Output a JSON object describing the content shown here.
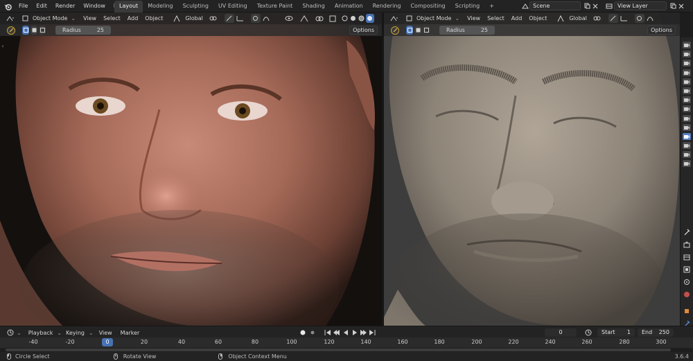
{
  "menu": [
    "File",
    "Edit",
    "Render",
    "Window",
    "Help"
  ],
  "workspace_tabs": [
    "Layout",
    "Modeling",
    "Sculpting",
    "UV Editing",
    "Texture Paint",
    "Shading",
    "Animation",
    "Rendering",
    "Compositing",
    "Scripting"
  ],
  "active_tab": "Layout",
  "add_workspace": "+",
  "scene": "Scene",
  "view_layer": "View Layer",
  "left_viewport": {
    "mode": "Object Mode",
    "menus": [
      "View",
      "Select",
      "Add",
      "Object"
    ],
    "orientation": "Global",
    "radius_label": "Radius",
    "radius_value": "25",
    "options": "Options"
  },
  "right_viewport": {
    "mode": "Object Mode",
    "menus": [
      "View",
      "Select",
      "Add",
      "Object"
    ],
    "orientation": "Global",
    "radius_label": "Radius",
    "radius_value": "25",
    "options": "Options"
  },
  "timeline": {
    "menus": [
      "Playback",
      "Keying",
      "View",
      "Marker"
    ],
    "current_frame": "0",
    "start_label": "Start",
    "start_value": "1",
    "end_label": "End",
    "end_value": "250",
    "ruler": [
      "-40",
      "-20",
      "0",
      "20",
      "40",
      "60",
      "80",
      "100",
      "120",
      "140",
      "160",
      "180",
      "200",
      "220",
      "240",
      "260",
      "280",
      "300"
    ],
    "playhead": "0"
  },
  "status": {
    "left": "Circle Select",
    "middle": "Rotate View",
    "right": "Object Context Menu",
    "version": "3.6.4"
  },
  "colors": {
    "accent": "#4772b3",
    "bg": "#1d1d1d",
    "header": "#232323",
    "clay": "#8d8478"
  }
}
